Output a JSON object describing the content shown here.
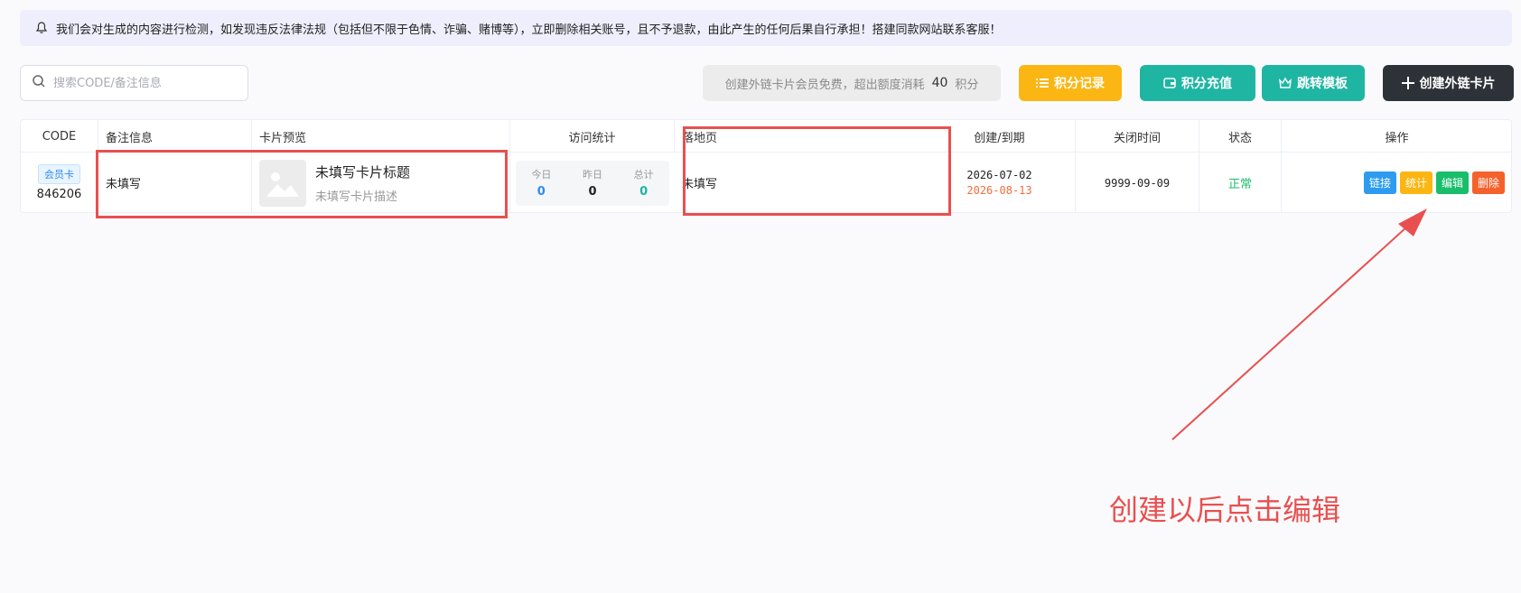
{
  "notice": {
    "icon": "bell-icon",
    "text": "我们会对生成的内容进行检测，如发现违反法律法规（包括但不限于色情、诈骗、赌博等），立即删除相关账号，且不予退款，由此产生的任何后果自行承担！搭建同款网站联系客服！"
  },
  "toolbar": {
    "search_placeholder": "搜索CODE/备注信息",
    "quota_text": "创建外链卡片会员免费，超出额度消耗",
    "quota_amount": "40",
    "quota_unit": "积分",
    "records_label": "积分记录",
    "recharge_label": "积分充值",
    "template_label": "跳转模板",
    "create_label": "创建外链卡片",
    "colors": {
      "records": "#fbb613",
      "recharge": "#1fb5a3",
      "template": "#1fb5a3",
      "create": "#2d3238"
    }
  },
  "table": {
    "headers": {
      "code": "CODE",
      "remark": "备注信息",
      "preview": "卡片预览",
      "visits": "访问统计",
      "landing": "落地页",
      "created_expire": "创建/到期",
      "close_time": "关闭时间",
      "status": "状态",
      "actions": "操作"
    },
    "rows": [
      {
        "tag": "会员卡",
        "code": "846206",
        "remark": "未填写",
        "card_title": "未填写卡片标题",
        "card_desc": "未填写卡片描述",
        "stats": [
          {
            "label": "今日",
            "value": "0",
            "color": "#2d8cf0"
          },
          {
            "label": "昨日",
            "value": "0",
            "color": "#222222"
          },
          {
            "label": "总计",
            "value": "0",
            "color": "#1fb5a3"
          }
        ],
        "landing": "未填写",
        "created": "2026-07-02",
        "expire": "2026-08-13",
        "close_time": "9999-09-09",
        "status": "正常",
        "actions": [
          {
            "label": "链接",
            "color": "#2d9cf0"
          },
          {
            "label": "统计",
            "color": "#fbb613"
          },
          {
            "label": "编辑",
            "color": "#19be6b"
          },
          {
            "label": "删除",
            "color": "#f5612c"
          }
        ]
      }
    ]
  },
  "annotation": {
    "text": "创建以后点击编辑",
    "color": "#e8504f"
  }
}
